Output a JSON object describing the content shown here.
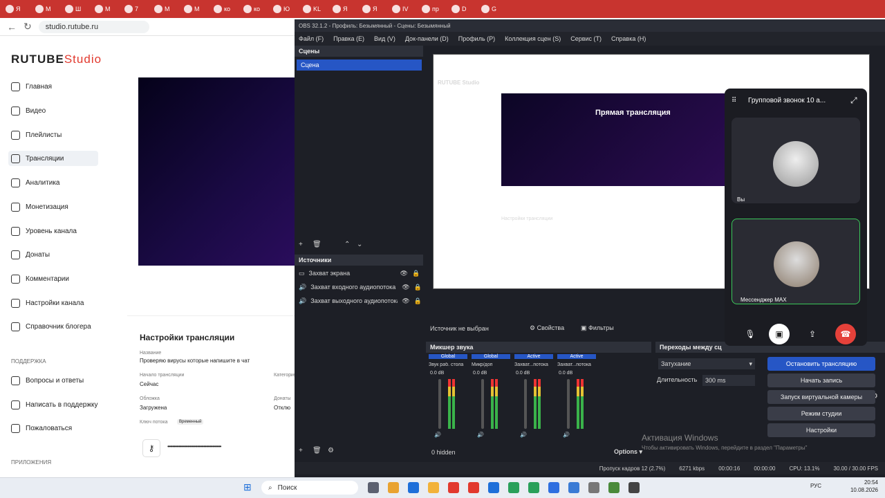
{
  "browser": {
    "url": "studio.rutube.ru",
    "tabs": [
      "Я",
      "М",
      "Ш",
      "М",
      "7",
      "М",
      "М",
      "ко",
      "ко",
      "Ю",
      "KL",
      "Я",
      "Я",
      "IV",
      "пр",
      "D",
      "G"
    ]
  },
  "rutube": {
    "logo_main": "RUTUBE",
    "logo_sub": "Studio",
    "nav": [
      "Главная",
      "Видео",
      "Плейлисты",
      "Трансляции",
      "Аналитика",
      "Монетизация",
      "Уровень канала",
      "Донаты",
      "Комментарии",
      "Настройки канала",
      "Справочник блогера"
    ],
    "support_head": "ПОДДЕРЖКА",
    "support": [
      "Вопросы и ответы",
      "Написать в поддержку",
      "Пожаловаться"
    ],
    "apps_head": "ПРИЛОЖЕНИЯ",
    "settings_title": "Настройки трансляции",
    "title_label": "Название",
    "title_value": "Проверяю вирусы которые напишите в чат",
    "start_label": "Начало трансляции",
    "start_value": "Сейчас",
    "cover_label": "Обложка",
    "cover_value": "Загружена",
    "key_label": "Ключ потока",
    "key_badge": "Временный",
    "key_value": "•••••••••••••••••••••••••••••••••••••••••••",
    "cat_label": "Категория",
    "donat_label": "Донаты",
    "donat_value": "Отклю"
  },
  "obs": {
    "title": "OBS 32.1.2 - Профиль: Безымянный - Сцены: Безымянный",
    "menu": [
      "Файл (F)",
      "Правка (E)",
      "Вид (V)",
      "Док-панели (D)",
      "Профиль (P)",
      "Коллекция сцен (S)",
      "Сервис (T)",
      "Справка (H)"
    ],
    "scenes_head": "Сцены",
    "scene": "Сцена",
    "sources_head": "Источники",
    "sources": [
      "Захват экрана",
      "Захват входного аудиопотока",
      "Захват выходного аудиопотока"
    ],
    "no_source": "Источник не выбран",
    "properties": "Свойства",
    "filters": "Фильтры",
    "mixer_head": "Микшер звука",
    "mixer": [
      {
        "tag": "Global",
        "name": "Звук раб. стола",
        "db": "0.0 dB"
      },
      {
        "tag": "Global",
        "name": "Микр/доп",
        "db": "0.0 dB"
      },
      {
        "tag": "Active",
        "name": "Захват...потока",
        "db": "0.0 dB"
      },
      {
        "tag": "Active",
        "name": "Захват...потока",
        "db": "0.0 dB"
      }
    ],
    "hidden": "0 hidden",
    "options": "Options",
    "transitions_head": "Переходы между сц",
    "transition": "Затухание",
    "duration_label": "Длительность",
    "duration": "300 ms",
    "buttons": [
      "Остановить трансляцию",
      "Начать запись",
      "Запуск виртуальной камеры",
      "Режим студии",
      "Настройки"
    ],
    "status": [
      "Пропуск кадров 12 (2.7%)",
      "6271 kbps",
      "00:00:16",
      "00:00:00",
      "CPU: 13.1%",
      "30.00 / 30.00 FPS"
    ],
    "canvas_hero": "Прямая трансляция",
    "canvas_settings": "Настройки трансляции",
    "canvas_logo": "RUTUBE Studio"
  },
  "call": {
    "title": "Групповой звонок 10 а...",
    "you": "Вы",
    "peer": "Мессенджер MAX"
  },
  "windows": {
    "activate": "Активация Windows",
    "activate_sub": "Чтобы активировать Windows, перейдите в раздел \"Параметры\"",
    "search": "Поиск",
    "lang": "РУС",
    "time": "20:54",
    "date": "10.08.2026"
  }
}
